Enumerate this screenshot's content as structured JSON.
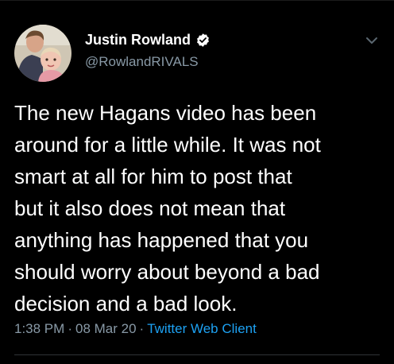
{
  "tweet": {
    "author": {
      "display_name": "Justin Rowland",
      "handle": "@RowlandRIVALS",
      "verified": true,
      "avatar_icon": "profile-photo"
    },
    "text": "The new Hagans video has been\naround for a little while. It was not\nsmart at all for him to post that\nbut it also does not mean that\nanything has happened that you\nshould worry about beyond a bad\ndecision and a bad look.",
    "time": "1:38 PM",
    "date": "08 Mar 20",
    "separator": "·",
    "client": "Twitter Web Client"
  },
  "icons": {
    "verified": "verified-badge-icon",
    "menu": "chevron-down-icon"
  },
  "colors": {
    "background": "#000000",
    "text": "#ffffff",
    "secondary": "#8899a6",
    "link": "#1da1f2",
    "verified": "#ffffff"
  }
}
